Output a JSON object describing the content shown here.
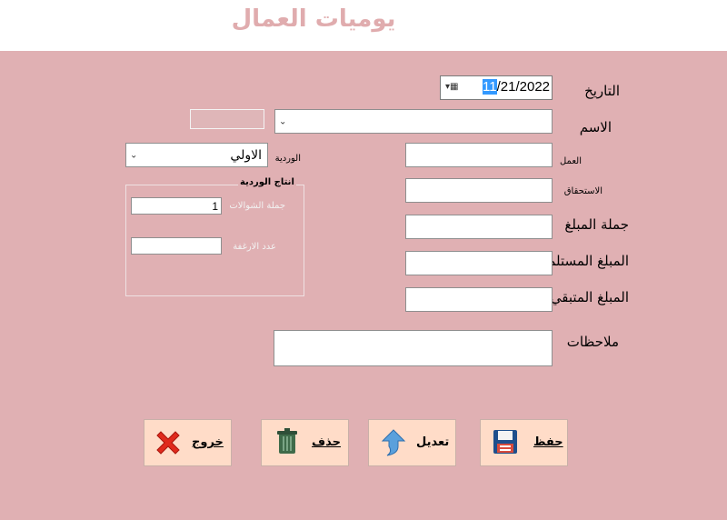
{
  "window": {
    "title": "يوميات العمال"
  },
  "form": {
    "date": {
      "label": "التاريخ",
      "month": "11",
      "rest": "/21/2022"
    },
    "name": {
      "label": "الاسم",
      "value": ""
    },
    "work": {
      "label": "العمل",
      "value": ""
    },
    "entitlement": {
      "label": "الاستحقاق",
      "value": ""
    },
    "total_amount": {
      "label": "جملة المبلغ",
      "value": ""
    },
    "received_amount": {
      "label": "المبلغ المستلم",
      "value": ""
    },
    "remaining_amount": {
      "label": "المبلغ المتبقي",
      "value": ""
    },
    "notes": {
      "label": "ملاحظات",
      "value": ""
    },
    "shift": {
      "label": "الوردية",
      "value": "الاولي"
    }
  },
  "shift_production": {
    "title": "انتاج الوردية",
    "sacks_total": {
      "label": "جملة الشوالات",
      "value": "1"
    },
    "loaves_count": {
      "label": "عدد الارغفة",
      "value": ""
    }
  },
  "buttons": {
    "save": "حفظ",
    "edit": "تعديل",
    "delete": "حذف",
    "exit": "خروج"
  },
  "colors": {
    "background": "#e0b0b3",
    "button": "#ffdcc8",
    "title": "#e0acae"
  }
}
